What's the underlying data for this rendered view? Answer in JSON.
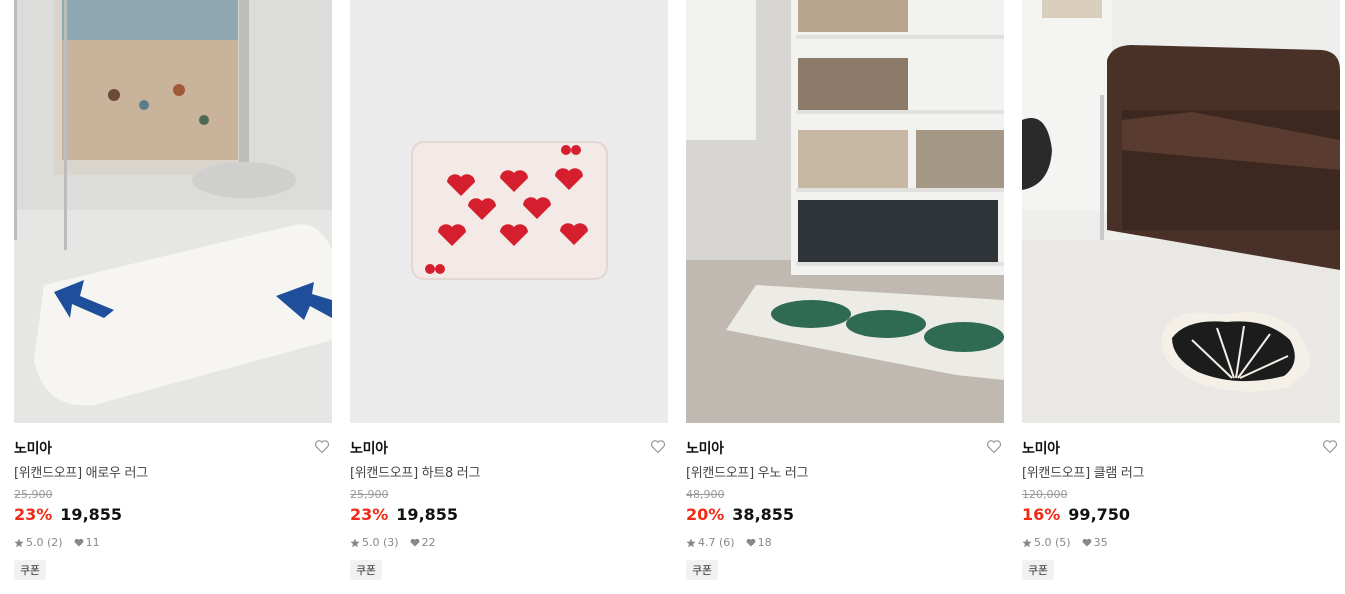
{
  "products": [
    {
      "brand": "노미아",
      "name": "[위캔드오프] 애로우 러그",
      "original_price": "25,900",
      "discount": "23%",
      "price": "19,855",
      "rating": "5.0 (2)",
      "likes": "11",
      "badge": "쿠폰"
    },
    {
      "brand": "노미아",
      "name": "[위캔드오프] 하트8 러그",
      "original_price": "25,900",
      "discount": "23%",
      "price": "19,855",
      "rating": "5.0 (3)",
      "likes": "22",
      "badge": "쿠폰"
    },
    {
      "brand": "노미아",
      "name": "[위캔드오프] 우노 러그",
      "original_price": "48,900",
      "discount": "20%",
      "price": "38,855",
      "rating": "4.7 (6)",
      "likes": "18",
      "badge": "쿠폰"
    },
    {
      "brand": "노미아",
      "name": "[위캔드오프] 클램 러그",
      "original_price": "120,000",
      "discount": "16%",
      "price": "99,750",
      "rating": "5.0 (5)",
      "likes": "35",
      "badge": "쿠폰"
    }
  ],
  "colors": {
    "discount": "#ef2b16",
    "coupon_bg": "#f1f1f1"
  },
  "icons": {
    "wishlist": "heart-outline-icon",
    "rating": "star-icon",
    "likes": "heart-filled-icon"
  }
}
